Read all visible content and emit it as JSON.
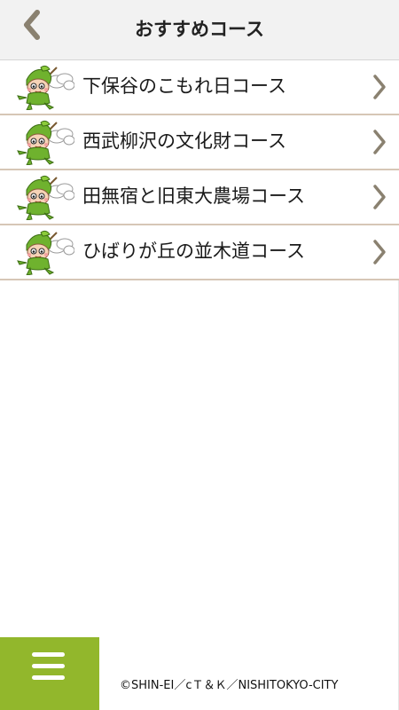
{
  "header": {
    "title": "おすすめコース",
    "back_icon": "chevron-left-icon"
  },
  "courses": [
    {
      "label": "下保谷のこもれ日コース",
      "icon": "mascot-icon",
      "chevron": "chevron-right-icon"
    },
    {
      "label": "西武柳沢の文化財コース",
      "icon": "mascot-icon",
      "chevron": "chevron-right-icon"
    },
    {
      "label": "田無宿と旧東大農場コース",
      "icon": "mascot-icon",
      "chevron": "chevron-right-icon"
    },
    {
      "label": "ひばりが丘の並木道コース",
      "icon": "mascot-icon",
      "chevron": "chevron-right-icon"
    }
  ],
  "footer": {
    "menu_icon": "hamburger-menu-icon",
    "copyright": "©SHIN-EI／cＴ＆Ｋ／NISHITOKYO-CITY"
  },
  "colors": {
    "accent_green": "#92b72c",
    "chevron": "#8a8170",
    "divider": "#d6c6b6",
    "header_bg": "#f2f2f2"
  }
}
